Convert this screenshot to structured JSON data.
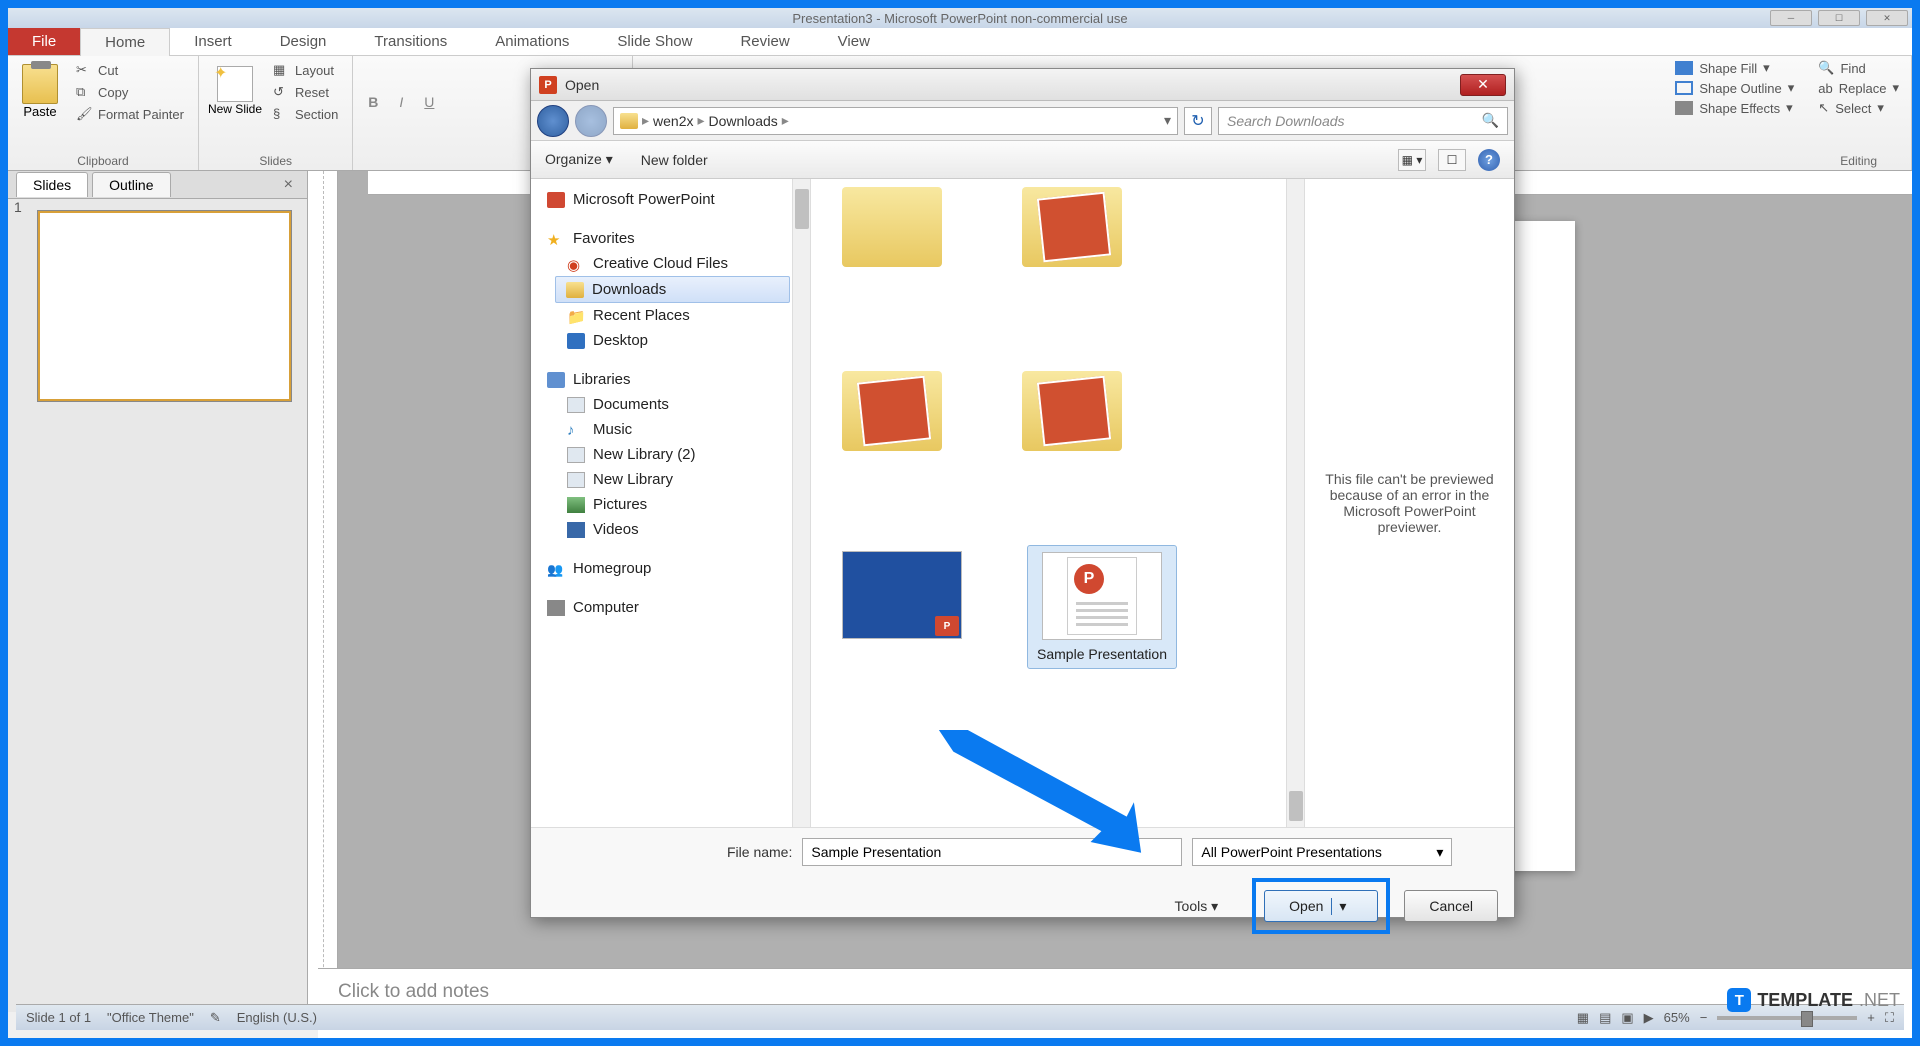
{
  "window": {
    "title": "Presentation3 - Microsoft PowerPoint non-commercial use"
  },
  "ribbon": {
    "tabs": {
      "file": "File",
      "home": "Home",
      "insert": "Insert",
      "design": "Design",
      "transitions": "Transitions",
      "animations": "Animations",
      "slideshow": "Slide Show",
      "review": "Review",
      "view": "View"
    },
    "clipboard": {
      "label": "Clipboard",
      "paste": "Paste",
      "cut": "Cut",
      "copy": "Copy",
      "format_painter": "Format Painter"
    },
    "slides": {
      "label": "Slides",
      "new_slide": "New Slide",
      "layout": "Layout",
      "reset": "Reset",
      "section": "Section"
    },
    "drawing": {
      "shape_fill": "Shape Fill",
      "shape_outline": "Shape Outline",
      "shape_effects": "Shape Effects"
    },
    "editing": {
      "label": "Editing",
      "find": "Find",
      "replace": "Replace",
      "select": "Select"
    }
  },
  "slides_panel": {
    "tab_slides": "Slides",
    "tab_outline": "Outline",
    "thumb_number": "1"
  },
  "notes": {
    "placeholder": "Click to add notes"
  },
  "status": {
    "slide_info": "Slide 1 of 1",
    "theme": "\"Office Theme\"",
    "language": "English (U.S.)",
    "zoom": "65%"
  },
  "dialog": {
    "title": "Open",
    "breadcrumb": {
      "user": "wen2x",
      "folder": "Downloads"
    },
    "search_placeholder": "Search Downloads",
    "toolbar": {
      "organize": "Organize",
      "new_folder": "New folder"
    },
    "tree": {
      "powerpoint": "Microsoft PowerPoint",
      "favorites": "Favorites",
      "creative_cloud": "Creative Cloud Files",
      "downloads": "Downloads",
      "recent_places": "Recent Places",
      "desktop": "Desktop",
      "libraries": "Libraries",
      "documents": "Documents",
      "music": "Music",
      "new_library_2": "New Library (2)",
      "new_library": "New Library",
      "pictures": "Pictures",
      "videos": "Videos",
      "homegroup": "Homegroup",
      "computer": "Computer"
    },
    "files": {
      "selected_label": "Sample Presentation"
    },
    "preview_message": "This file can't be previewed because of an error in the Microsoft PowerPoint previewer.",
    "filename_label": "File name:",
    "filename_value": "Sample Presentation",
    "filetype": "All PowerPoint Presentations",
    "tools_label": "Tools",
    "open_btn": "Open",
    "cancel_btn": "Cancel"
  },
  "watermark": {
    "brand": "TEMPLATE",
    "suffix": ".NET"
  }
}
